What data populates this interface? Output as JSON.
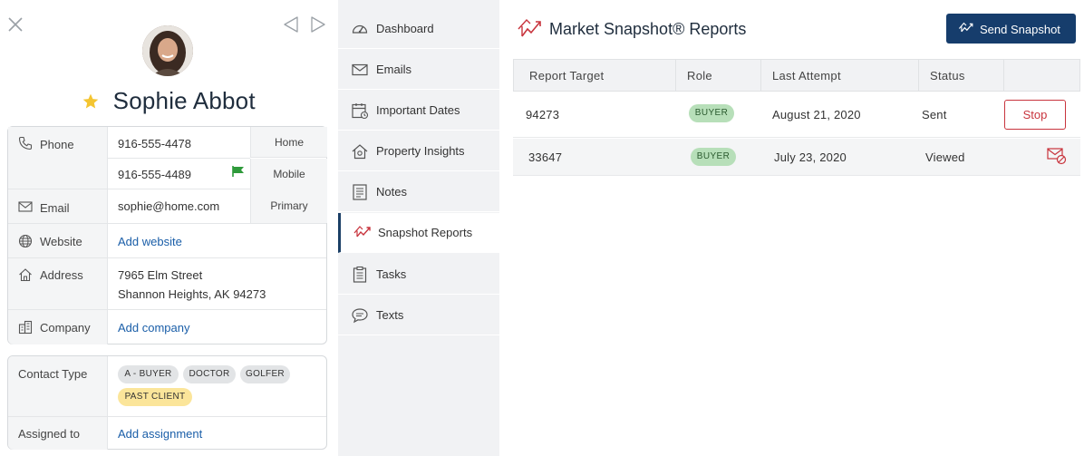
{
  "contact": {
    "name": "Sophie Abbot",
    "favorite": true,
    "phone": {
      "label": "Phone",
      "numbers": [
        {
          "value": "916-555-4478",
          "type": "Home"
        },
        {
          "value": "916-555-4489",
          "type": "Mobile",
          "flagged": true
        }
      ]
    },
    "email": {
      "label": "Email",
      "value": "sophie@home.com",
      "type": "Primary"
    },
    "website": {
      "label": "Website",
      "action": "Add website"
    },
    "address": {
      "label": "Address",
      "line1": "7965 Elm Street",
      "line2": "Shannon Heights, AK 94273"
    },
    "company": {
      "label": "Company",
      "action": "Add company"
    },
    "contact_type": {
      "label": "Contact Type",
      "tags": [
        "A - BUYER",
        "DOCTOR",
        "GOLFER",
        "PAST CLIENT"
      ]
    },
    "assigned": {
      "label": "Assigned to",
      "action": "Add assignment"
    }
  },
  "nav": {
    "items": [
      {
        "label": "Dashboard",
        "icon": "gauge-icon"
      },
      {
        "label": "Emails",
        "icon": "envelope-icon"
      },
      {
        "label": "Important Dates",
        "icon": "calendar-icon"
      },
      {
        "label": "Property Insights",
        "icon": "house-icon"
      },
      {
        "label": "Notes",
        "icon": "note-icon"
      },
      {
        "label": "Snapshot Reports",
        "icon": "snapshot-icon",
        "active": true
      },
      {
        "label": "Tasks",
        "icon": "clipboard-icon"
      },
      {
        "label": "Texts",
        "icon": "chat-icon"
      }
    ]
  },
  "main": {
    "title": "Market Snapshot® Reports",
    "send_button": "Send Snapshot",
    "table": {
      "headers": [
        "Report Target",
        "Role",
        "Last Attempt",
        "Status"
      ],
      "rows": [
        {
          "target": "94273",
          "role": "BUYER",
          "last_attempt": "August 21, 2020",
          "status": "Sent",
          "action": "Stop"
        },
        {
          "target": "33647",
          "role": "BUYER",
          "last_attempt": "July 23, 2020",
          "status": "Viewed",
          "action_icon": "mail-stop-icon"
        }
      ]
    }
  },
  "colors": {
    "accent": "#163d6c",
    "danger": "#c8343d",
    "link": "#1a5ea8",
    "badge_green": "#b7dfb9",
    "tag_yellow": "#fbe59a"
  }
}
